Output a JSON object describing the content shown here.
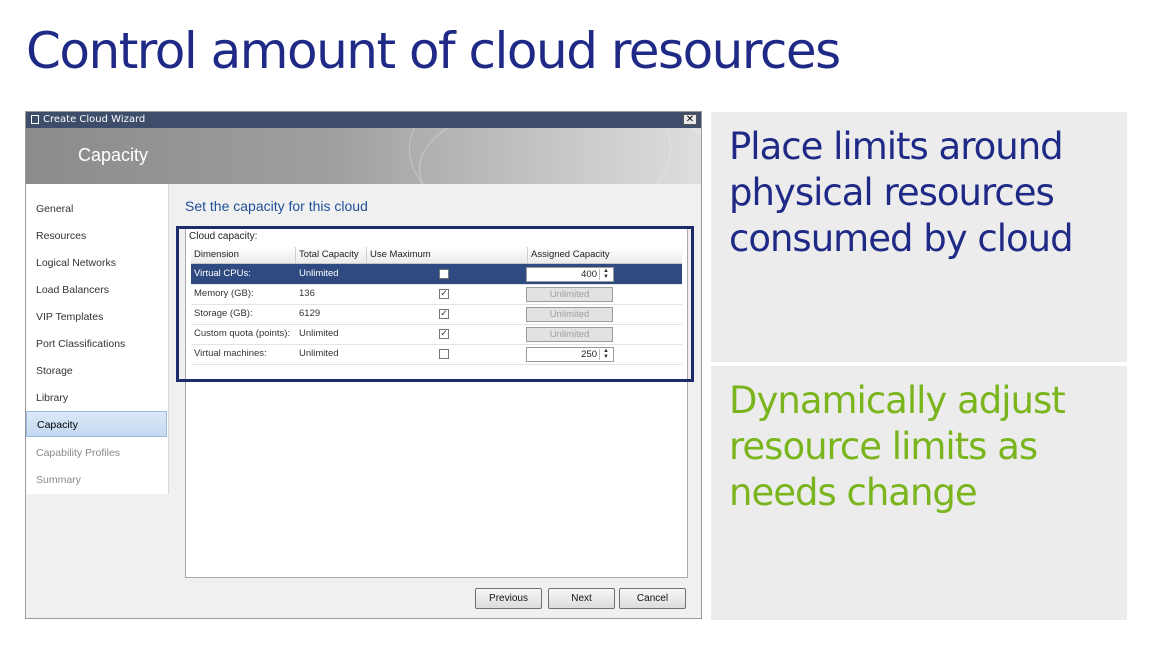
{
  "slide": {
    "title": "Control amount of cloud resources",
    "callouts": [
      {
        "lines": [
          "Place limits around",
          "physical resources",
          "consumed by cloud"
        ],
        "color": "#1f2a86"
      },
      {
        "lines": [
          "Dynamically adjust",
          "resource limits as",
          "needs change"
        ],
        "color": "#7ab51d"
      }
    ]
  },
  "wizard": {
    "window_title": "Create Cloud Wizard",
    "close_glyph": "✕",
    "banner_title": "Capacity",
    "nav_items": [
      {
        "label": "General",
        "state": "normal"
      },
      {
        "label": "Resources",
        "state": "normal"
      },
      {
        "label": "Logical Networks",
        "state": "normal"
      },
      {
        "label": "Load Balancers",
        "state": "normal"
      },
      {
        "label": "VIP Templates",
        "state": "normal"
      },
      {
        "label": "Port Classifications",
        "state": "normal"
      },
      {
        "label": "Storage",
        "state": "normal"
      },
      {
        "label": "Library",
        "state": "normal"
      },
      {
        "label": "Capacity",
        "state": "selected"
      },
      {
        "label": "Capability Profiles",
        "state": "disabled"
      },
      {
        "label": "Summary",
        "state": "disabled"
      }
    ],
    "heading": "Set the capacity for this cloud",
    "capacity_label": "Cloud capacity:",
    "grid": {
      "columns": [
        "Dimension",
        "Total Capacity",
        "Use Maximum",
        "Assigned Capacity"
      ],
      "rows": [
        {
          "dimension": "Virtual CPUs:",
          "total": "Unlimited",
          "use_max": false,
          "assigned": "400",
          "assigned_enabled": true,
          "selected": true
        },
        {
          "dimension": "Memory (GB):",
          "total": "136",
          "use_max": true,
          "assigned": "Unlimited",
          "assigned_enabled": false,
          "selected": false
        },
        {
          "dimension": "Storage (GB):",
          "total": "6129",
          "use_max": true,
          "assigned": "Unlimited",
          "assigned_enabled": false,
          "selected": false
        },
        {
          "dimension": "Custom quota (points):",
          "total": "Unlimited",
          "use_max": true,
          "assigned": "Unlimited",
          "assigned_enabled": false,
          "selected": false
        },
        {
          "dimension": "Virtual machines:",
          "total": "Unlimited",
          "use_max": false,
          "assigned": "250",
          "assigned_enabled": true,
          "selected": false
        }
      ]
    },
    "buttons": {
      "previous": "Previous",
      "next": "Next",
      "cancel": "Cancel"
    },
    "check_glyph": "✓",
    "spin_glyphs": "▲▼"
  }
}
